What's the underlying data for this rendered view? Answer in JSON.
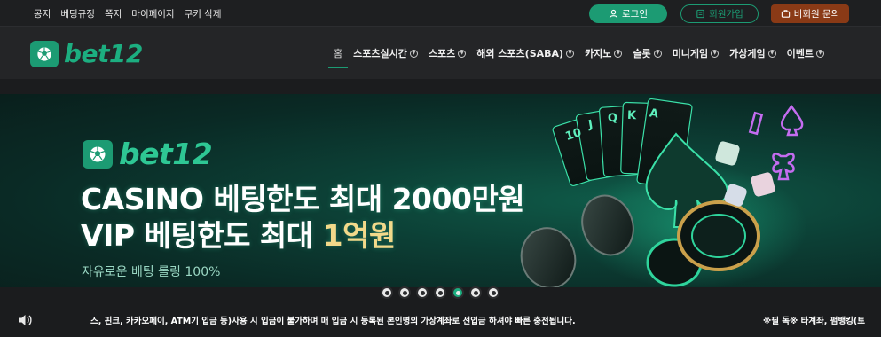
{
  "top_links": [
    "공지",
    "베팅규정",
    "쪽지",
    "마이페이지",
    "쿠키 삭제"
  ],
  "auth": {
    "login_label": "로그인",
    "join_label": "회원가입",
    "guest_label": "비회원 문의"
  },
  "brand": {
    "logo_text": "bet12",
    "accent_color": "#1c9b73"
  },
  "nav": {
    "items": [
      {
        "label": "홈",
        "has_menu": false
      },
      {
        "label": "스포츠실시간",
        "has_menu": true
      },
      {
        "label": "스포츠",
        "has_menu": true
      },
      {
        "label": "해외 스포츠(SABA)",
        "has_menu": true
      },
      {
        "label": "카지노",
        "has_menu": true
      },
      {
        "label": "슬롯",
        "has_menu": true
      },
      {
        "label": "미니게임",
        "has_menu": true
      },
      {
        "label": "가상게임",
        "has_menu": true
      },
      {
        "label": "이벤트",
        "has_menu": true
      }
    ]
  },
  "banner": {
    "logo_text": "bet12",
    "line1": "CASINO 베팅한도 최대 2000만원",
    "line2_prefix": "VIP 베팅한도 최대 ",
    "line2_highlight": "1억원",
    "subtitle": "자유로운 베팅 롤링 100%",
    "slide_count": 7,
    "active_slide": 5,
    "cards": [
      "10",
      "J",
      "Q",
      "K",
      "A"
    ]
  },
  "ticker": {
    "text": "스, 핀크, 카카오페이, ATM기 입금 등)사용 시 입금이 불가하며 매 입금 시 등록된 본인명의 가상계좌로 선입금 하셔야 빠른 충전됩니다.",
    "right_text": "※필 독※ 타계좌, 펌뱅킹(토"
  }
}
